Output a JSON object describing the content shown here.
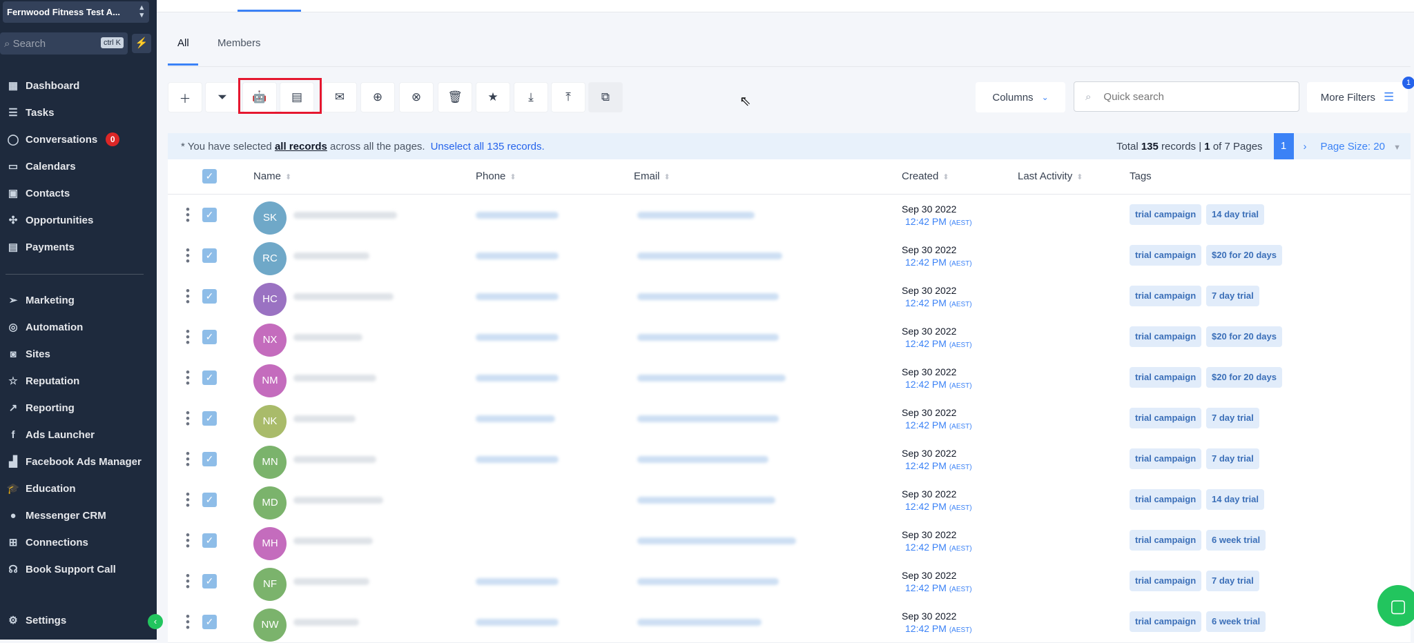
{
  "account": {
    "name": "Fernwood Fitness Test A..."
  },
  "sidebar": {
    "search_placeholder": "Search",
    "search_shortcut": "ctrl K",
    "items": [
      {
        "label": "Dashboard",
        "icon": "dashboard-icon",
        "glyph": "▦"
      },
      {
        "label": "Tasks",
        "icon": "tasks-icon",
        "glyph": "☰"
      },
      {
        "label": "Conversations",
        "icon": "chat-icon",
        "glyph": "◯",
        "badge": "0"
      },
      {
        "label": "Calendars",
        "icon": "calendar-icon",
        "glyph": "▭"
      },
      {
        "label": "Contacts",
        "icon": "contacts-icon",
        "glyph": "▣"
      },
      {
        "label": "Opportunities",
        "icon": "opportunities-icon",
        "glyph": "✣"
      },
      {
        "label": "Payments",
        "icon": "payments-icon",
        "glyph": "▤"
      },
      {
        "label": "Marketing",
        "icon": "send-icon",
        "glyph": "➢"
      },
      {
        "label": "Automation",
        "icon": "automation-icon",
        "glyph": "◎"
      },
      {
        "label": "Sites",
        "icon": "sites-icon",
        "glyph": "◙"
      },
      {
        "label": "Reputation",
        "icon": "star-icon",
        "glyph": "☆"
      },
      {
        "label": "Reporting",
        "icon": "trend-icon",
        "glyph": "↗"
      },
      {
        "label": "Ads Launcher",
        "icon": "facebook-icon",
        "glyph": "f"
      },
      {
        "label": "Facebook Ads Manager",
        "icon": "bar-chart-icon",
        "glyph": "▟"
      },
      {
        "label": "Education",
        "icon": "graduation-cap-icon",
        "glyph": "🎓"
      },
      {
        "label": "Messenger CRM",
        "icon": "messenger-icon",
        "glyph": "●"
      },
      {
        "label": "Connections",
        "icon": "network-icon",
        "glyph": "⊞"
      },
      {
        "label": "Book Support Call",
        "icon": "headset-icon",
        "glyph": "☊"
      }
    ],
    "settings_label": "Settings"
  },
  "tabs": [
    {
      "label": "All"
    },
    {
      "label": "Members"
    }
  ],
  "toolbar": {
    "columns_label": "Columns",
    "search_placeholder": "Quick search",
    "more_filters_label": "More Filters",
    "more_filters_badge": "1"
  },
  "selection": {
    "prefix": "* You have selected",
    "bold": "all records",
    "suffix": "across all the pages.",
    "unselect": "Unselect all 135 records.",
    "total_prefix": "Total",
    "total_count": "135",
    "total_mid": "records |",
    "page_current": "1",
    "page_of": "of 7 Pages",
    "page_button": "1",
    "page_size": "Page Size: 20"
  },
  "columns": {
    "name": "Name",
    "phone": "Phone",
    "email": "Email",
    "created": "Created",
    "last_activity": "Last Activity",
    "tags": "Tags"
  },
  "rows": [
    {
      "initials": "SK",
      "color": "#6fa8c8",
      "date": "Sep 30 2022",
      "time": "12:42 PM",
      "tz": "(AEST)",
      "tags": [
        "trial campaign",
        "14 day trial"
      ]
    },
    {
      "initials": "RC",
      "color": "#6fa8c8",
      "date": "Sep 30 2022",
      "time": "12:42 PM",
      "tz": "(AEST)",
      "tags": [
        "trial campaign",
        "$20 for 20 days"
      ]
    },
    {
      "initials": "HC",
      "color": "#9a72c2",
      "date": "Sep 30 2022",
      "time": "12:42 PM",
      "tz": "(AEST)",
      "tags": [
        "trial campaign",
        "7 day trial"
      ]
    },
    {
      "initials": "NX",
      "color": "#c46cbd",
      "date": "Sep 30 2022",
      "time": "12:42 PM",
      "tz": "(AEST)",
      "tags": [
        "trial campaign",
        "$20 for 20 days"
      ]
    },
    {
      "initials": "NM",
      "color": "#c46cbd",
      "date": "Sep 30 2022",
      "time": "12:42 PM",
      "tz": "(AEST)",
      "tags": [
        "trial campaign",
        "$20 for 20 days"
      ]
    },
    {
      "initials": "NK",
      "color": "#a9bb6a",
      "date": "Sep 30 2022",
      "time": "12:42 PM",
      "tz": "(AEST)",
      "tags": [
        "trial campaign",
        "7 day trial"
      ]
    },
    {
      "initials": "MN",
      "color": "#7bb36c",
      "date": "Sep 30 2022",
      "time": "12:42 PM",
      "tz": "(AEST)",
      "tags": [
        "trial campaign",
        "7 day trial"
      ]
    },
    {
      "initials": "MD",
      "color": "#7bb36c",
      "date": "Sep 30 2022",
      "time": "12:42 PM",
      "tz": "(AEST)",
      "tags": [
        "trial campaign",
        "14 day trial"
      ]
    },
    {
      "initials": "MH",
      "color": "#c46cbd",
      "date": "Sep 30 2022",
      "time": "12:42 PM",
      "tz": "(AEST)",
      "tags": [
        "trial campaign",
        "6 week trial"
      ]
    },
    {
      "initials": "NF",
      "color": "#7bb36c",
      "date": "Sep 30 2022",
      "time": "12:42 PM",
      "tz": "(AEST)",
      "tags": [
        "trial campaign",
        "7 day trial"
      ]
    },
    {
      "initials": "NW",
      "color": "#7bb36c",
      "date": "Sep 30 2022",
      "time": "12:42 PM",
      "tz": "(AEST)",
      "tags": [
        "trial campaign",
        "6 week trial"
      ]
    }
  ],
  "colors": {
    "accent": "#3b82f6",
    "sidebar": "#1e2a3d",
    "highlight": "#e5172f",
    "tag_bg": "#e1ecfa"
  }
}
